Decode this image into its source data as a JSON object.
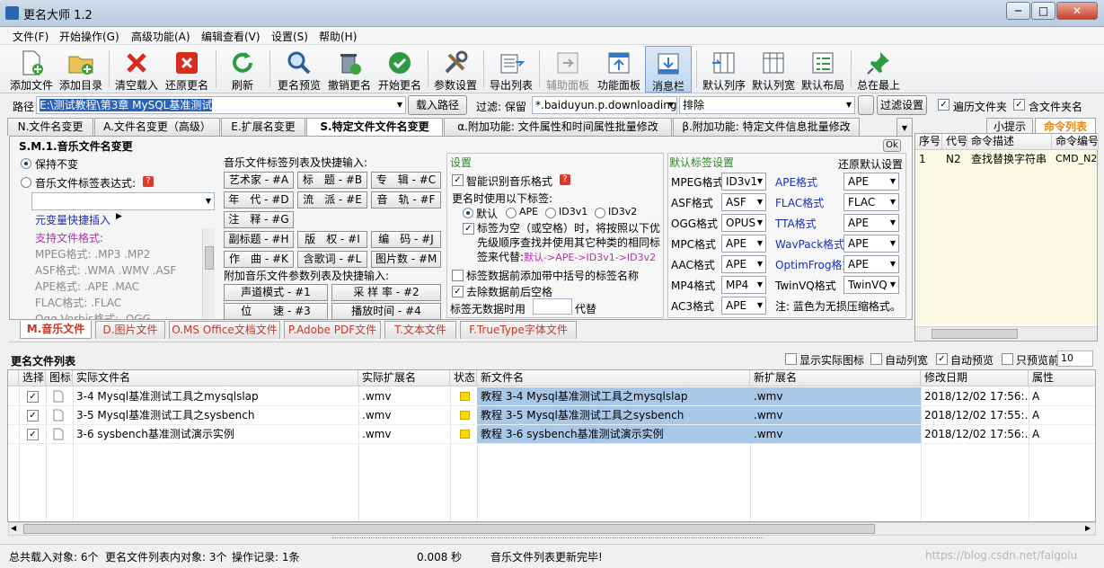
{
  "window": {
    "title": "更名大师 1.2",
    "min": "─",
    "max": "□",
    "close": "✕"
  },
  "menu": [
    "文件(F)",
    "开始操作(G)",
    "高级功能(A)",
    "编辑查看(V)",
    "设置(S)",
    "帮助(H)"
  ],
  "toolbar": [
    "添加文件",
    "添加目录",
    "清空载入",
    "还原更名",
    "刷新",
    "更名预览",
    "撤销更名",
    "开始更名",
    "参数设置",
    "导出列表",
    "辅助面板",
    "功能面板",
    "消息栏",
    "默认列序",
    "默认列宽",
    "默认布局",
    "总在最上"
  ],
  "pathbar": {
    "path_label": "路径",
    "path_value": "E:\\测试教程\\第3章 MySQL基准测试",
    "load_btn": "载入路径",
    "filter_label": "过滤: 保留",
    "filter_value": "*.baiduyun.p.downloading",
    "exclude_value": "排除",
    "filter_btn": "过滤设置",
    "traverse": "遍历文件夹",
    "include_dir": "含文件夹名"
  },
  "tabs_top": [
    "N.文件名变更",
    "A.文件名变更（高级）",
    "E.扩展名变更",
    "S.特定文件文件名变更",
    "α.附加功能: 文件属性和时间属性批量修改",
    "β.附加功能: 特定文件信息批量修改"
  ],
  "panel": {
    "title": "S.M.1.音乐文件名变更",
    "keep": "保持不变",
    "expr": "音乐文件标签表达式:",
    "help": "?",
    "quick_insert": "元变量快捷插入",
    "formats_title": "支持文件格式:",
    "formats": [
      "MPEG格式: .MP3 .MP2",
      "ASF格式: .WMA .WMV .ASF",
      "APE格式: .APE .MAC",
      "FLAC格式: .FLAC",
      "Ogg Vorbis格式: .OGG"
    ],
    "tag_list_title": "音乐文件标签列表及快捷输入:",
    "tags": [
      "艺术家 - #A",
      "标　题 - #B",
      "专　辑 - #C",
      "年　代 - #D",
      "流　派 - #E",
      "音　轨 - #F",
      "注　释 - #G",
      "副标题 - #H",
      "版　权 - #I",
      "编　码 - #J",
      "作　曲 - #K",
      "含歌词 - #L",
      "图片数 - #M"
    ],
    "extra_title": "附加音乐文件参数列表及快捷输入:",
    "extras": [
      "声道模式 - #1",
      "采 样 率 - #2",
      "位　　速 - #3",
      "播放时间 - #4"
    ],
    "settings_title": "设置",
    "smart": "智能识别音乐格式",
    "use_tags": "更名时使用以下标签:",
    "tag_opts": [
      "默认",
      "APE",
      "ID3v1",
      "ID3v2"
    ],
    "empty_tag": "标签为空（或空格）时，将按照以下优先级顺序查找并使用其它种类的相同标签来代替:",
    "empty_tag_hint": "默认->APE->ID3v1->ID3v2",
    "add_prefix": "标签数据前添加带中括号的标签名称",
    "strip_space": "去除数据前后空格",
    "no_data": "标签无数据时用",
    "replace": "代替",
    "default_title": "默认标签设置",
    "restore": "还原默认设置",
    "defaults": [
      {
        "l": "MPEG格式",
        "v": "ID3v1",
        "l2": "APE格式",
        "v2": "APE"
      },
      {
        "l": "ASF格式",
        "v": "ASF",
        "l2": "FLAC格式",
        "v2": "FLAC"
      },
      {
        "l": "OGG格式",
        "v": "OPUS",
        "l2": "TTA格式",
        "v2": "APE"
      },
      {
        "l": "MPC格式",
        "v": "APE",
        "l2": "WavPack格式",
        "v2": "APE"
      },
      {
        "l": "AAC格式",
        "v": "APE",
        "l2": "OptimFrog格式",
        "v2": "APE"
      },
      {
        "l": "MP4格式",
        "v": "MP4",
        "l2": "TwinVQ格式",
        "v2": "TwinVQ"
      },
      {
        "l": "AC3格式",
        "v": "APE",
        "l2": "注: 蓝色为无损压缩格式。",
        "v2": ""
      }
    ],
    "ok": "Ok"
  },
  "tabs_bottom": [
    "M.音乐文件",
    "D.图片文件",
    "O.MS Office文档文件",
    "P.Adobe PDF文件",
    "T.文本文件",
    "F.TrueType字体文件"
  ],
  "right_panel": {
    "tabs": [
      "小提示",
      "命令列表"
    ],
    "headers": [
      "序号",
      "代号",
      "命令描述",
      "命令编号"
    ],
    "row": [
      "1",
      "N2",
      "查找替换字符串",
      "CMD_N22"
    ]
  },
  "list": {
    "title": "更名文件列表",
    "opts": [
      "显示实际图标",
      "自动列宽",
      "自动预览",
      "只预览前"
    ],
    "preview_count": "10",
    "headers": [
      "选择",
      "图标",
      "实际文件名",
      "实际扩展名",
      "状态",
      "新文件名",
      "新扩展名",
      "修改日期",
      "属性"
    ],
    "rows": [
      {
        "name": "3-4 Mysql基准测试工具之mysqlslap",
        "ext": ".wmv",
        "new": "教程 3-4 Mysql基准测试工具之mysqlslap",
        "newext": ".wmv",
        "date": "2018/12/02 17:56:...",
        "attr": "A"
      },
      {
        "name": "3-5 Mysql基准测试工具之sysbench",
        "ext": ".wmv",
        "new": "教程 3-5 Mysql基准测试工具之sysbench",
        "newext": ".wmv",
        "date": "2018/12/02 17:55:...",
        "attr": "A"
      },
      {
        "name": "3-6 sysbench基准测试演示实例",
        "ext": ".wmv",
        "new": "教程 3-6 sysbench基准测试演示实例",
        "newext": ".wmv",
        "date": "2018/12/02 17:56:...",
        "attr": "A"
      }
    ]
  },
  "status": {
    "total": "总共载入对象: 6个",
    "list": "更名文件列表内对象: 3个",
    "log": "操作记录: 1条",
    "time": "0.008 秒",
    "msg": "音乐文件列表更新完毕!",
    "watermark": "https://blog.csdn.net/falgolu"
  },
  "colors": {
    "highlight": "#a9c8e8",
    "status_icon": "#ffd800",
    "selected_text": "#2a62b8"
  }
}
